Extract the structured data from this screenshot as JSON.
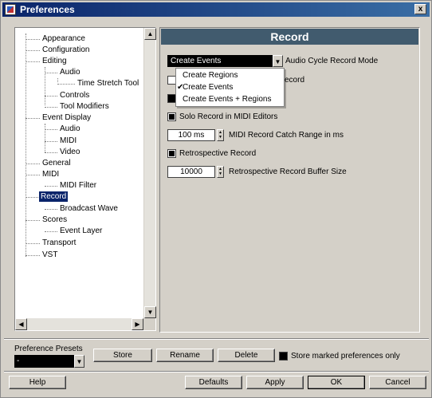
{
  "window": {
    "title": "Preferences",
    "close_label": "x"
  },
  "tree": {
    "items": [
      {
        "label": "Appearance"
      },
      {
        "label": "Configuration"
      },
      {
        "label": "Editing"
      },
      {
        "label": "Audio"
      },
      {
        "label": "Time Stretch Tool"
      },
      {
        "label": "Controls"
      },
      {
        "label": "Tool Modifiers"
      },
      {
        "label": "Event Display"
      },
      {
        "label": "Audio"
      },
      {
        "label": "MIDI"
      },
      {
        "label": "Video"
      },
      {
        "label": "General"
      },
      {
        "label": "MIDI"
      },
      {
        "label": "MIDI Filter"
      },
      {
        "label": "Record"
      },
      {
        "label": "Broadcast Wave"
      },
      {
        "label": "Scores"
      },
      {
        "label": "Event Layer"
      },
      {
        "label": "Transport"
      },
      {
        "label": "VST"
      }
    ],
    "selected": "Record"
  },
  "panel": {
    "title": "Record",
    "cycle_mode": {
      "value": "Create Events",
      "label": "Audio Cycle Record Mode",
      "menu": [
        {
          "label": "Create Regions",
          "checked": false
        },
        {
          "label": "Create Events",
          "checked": true
        },
        {
          "label": "Create Events + Regions",
          "checked": false
        }
      ],
      "hidden_label_tail": "ecord"
    },
    "solo_midi": {
      "label": "Solo Record in MIDI Editors",
      "checked": true
    },
    "catch_range": {
      "value": "100 ms",
      "label": "MIDI Record Catch Range in ms"
    },
    "retro": {
      "label": "Retrospective Record",
      "checked": true
    },
    "retro_buffer": {
      "value": "10000",
      "label": "Retrospective Record Buffer Size"
    }
  },
  "presets": {
    "label": "Preference Presets",
    "selected": "-",
    "store": "Store",
    "rename": "Rename",
    "delete": "Delete",
    "store_marked": "Store marked preferences only"
  },
  "footer": {
    "help": "Help",
    "defaults": "Defaults",
    "apply": "Apply",
    "ok": "OK",
    "cancel": "Cancel"
  }
}
